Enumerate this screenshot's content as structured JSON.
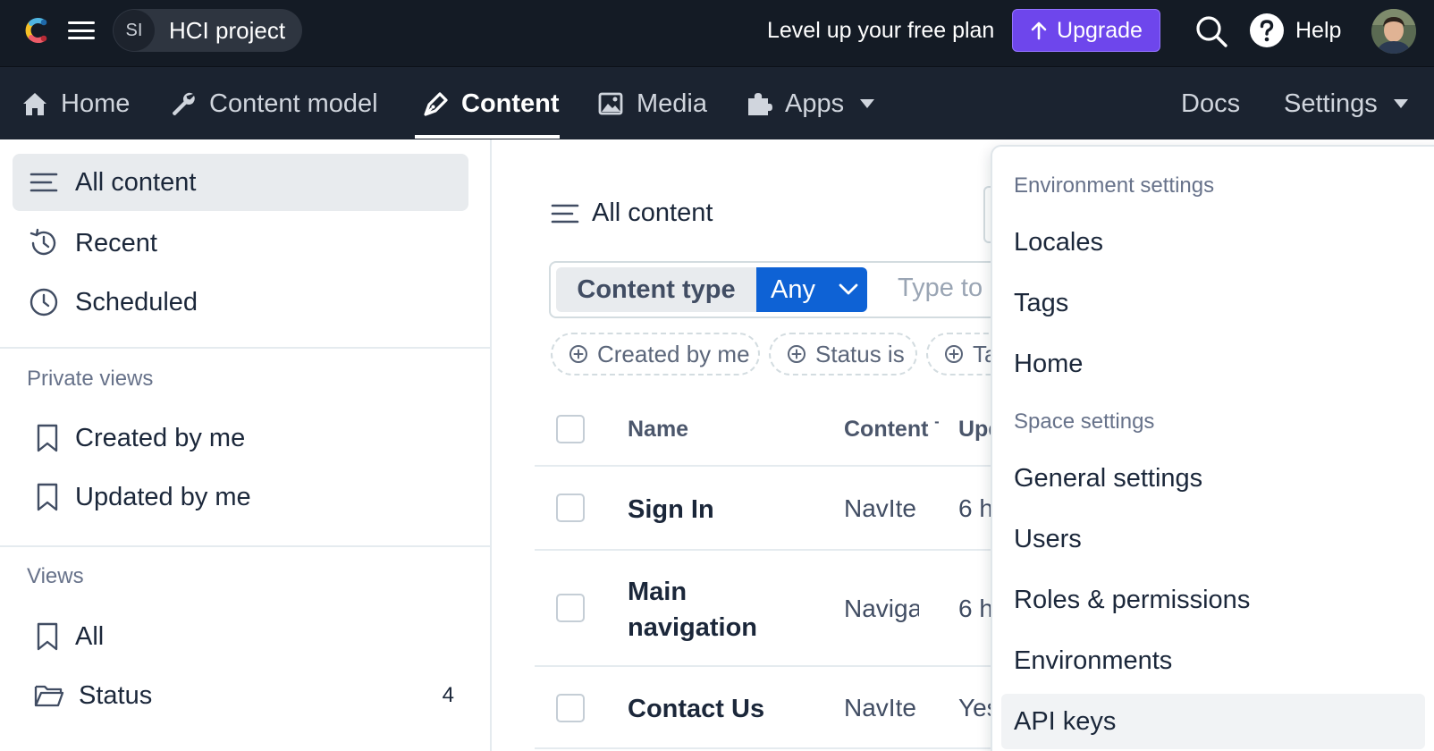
{
  "topbar": {
    "space_initials": "SI",
    "space_name": "HCI project",
    "promo_text": "Level up your free plan",
    "upgrade_label": "Upgrade",
    "help_label": "Help"
  },
  "nav": {
    "items": [
      {
        "label": "Home",
        "icon": "home-icon"
      },
      {
        "label": "Content model",
        "icon": "wrench-icon"
      },
      {
        "label": "Content",
        "icon": "pen-icon",
        "active": true
      },
      {
        "label": "Media",
        "icon": "image-icon"
      },
      {
        "label": "Apps",
        "icon": "puzzle-icon"
      }
    ],
    "docs_label": "Docs",
    "settings_label": "Settings"
  },
  "sidebar": {
    "items": [
      {
        "label": "All content",
        "icon": "list-icon",
        "active": true
      },
      {
        "label": "Recent",
        "icon": "history-icon"
      },
      {
        "label": "Scheduled",
        "icon": "clock-icon"
      }
    ],
    "private_heading": "Private views",
    "private_views": [
      "Created by me",
      "Updated by me"
    ],
    "views_heading": "Views",
    "views": [
      {
        "label": "All",
        "icon": "bookmark-icon"
      },
      {
        "label": "Status",
        "icon": "folder-icon",
        "count": "4"
      }
    ]
  },
  "main": {
    "title": "All content",
    "content_type_label": "Content type",
    "content_type_value": "Any",
    "search_placeholder": "Type to",
    "chips": [
      "Created by me",
      "Status is",
      "Ta"
    ],
    "columns": [
      "Name",
      "Content ˉ",
      "Upd"
    ],
    "rows": [
      {
        "name": "Sign In",
        "type": "NavIte",
        "updated": "6 h"
      },
      {
        "name_line1": "Main",
        "name_line2": "navigation",
        "type": "Naviga",
        "updated": "6 h"
      },
      {
        "name": "Contact Us",
        "type": "NavIte",
        "updated": "Yes"
      }
    ]
  },
  "settings_menu": {
    "env_heading": "Environment settings",
    "env_items": [
      "Locales",
      "Tags",
      "Home"
    ],
    "space_heading": "Space settings",
    "space_items": [
      "General settings",
      "Users",
      "Roles & permissions",
      "Environments",
      "API keys"
    ]
  },
  "colors": {
    "topbar_bg": "#141b25",
    "navbar_bg": "#1b2330",
    "upgrade_purple": "#6e46ec",
    "primary_blue": "#0e62d5"
  }
}
